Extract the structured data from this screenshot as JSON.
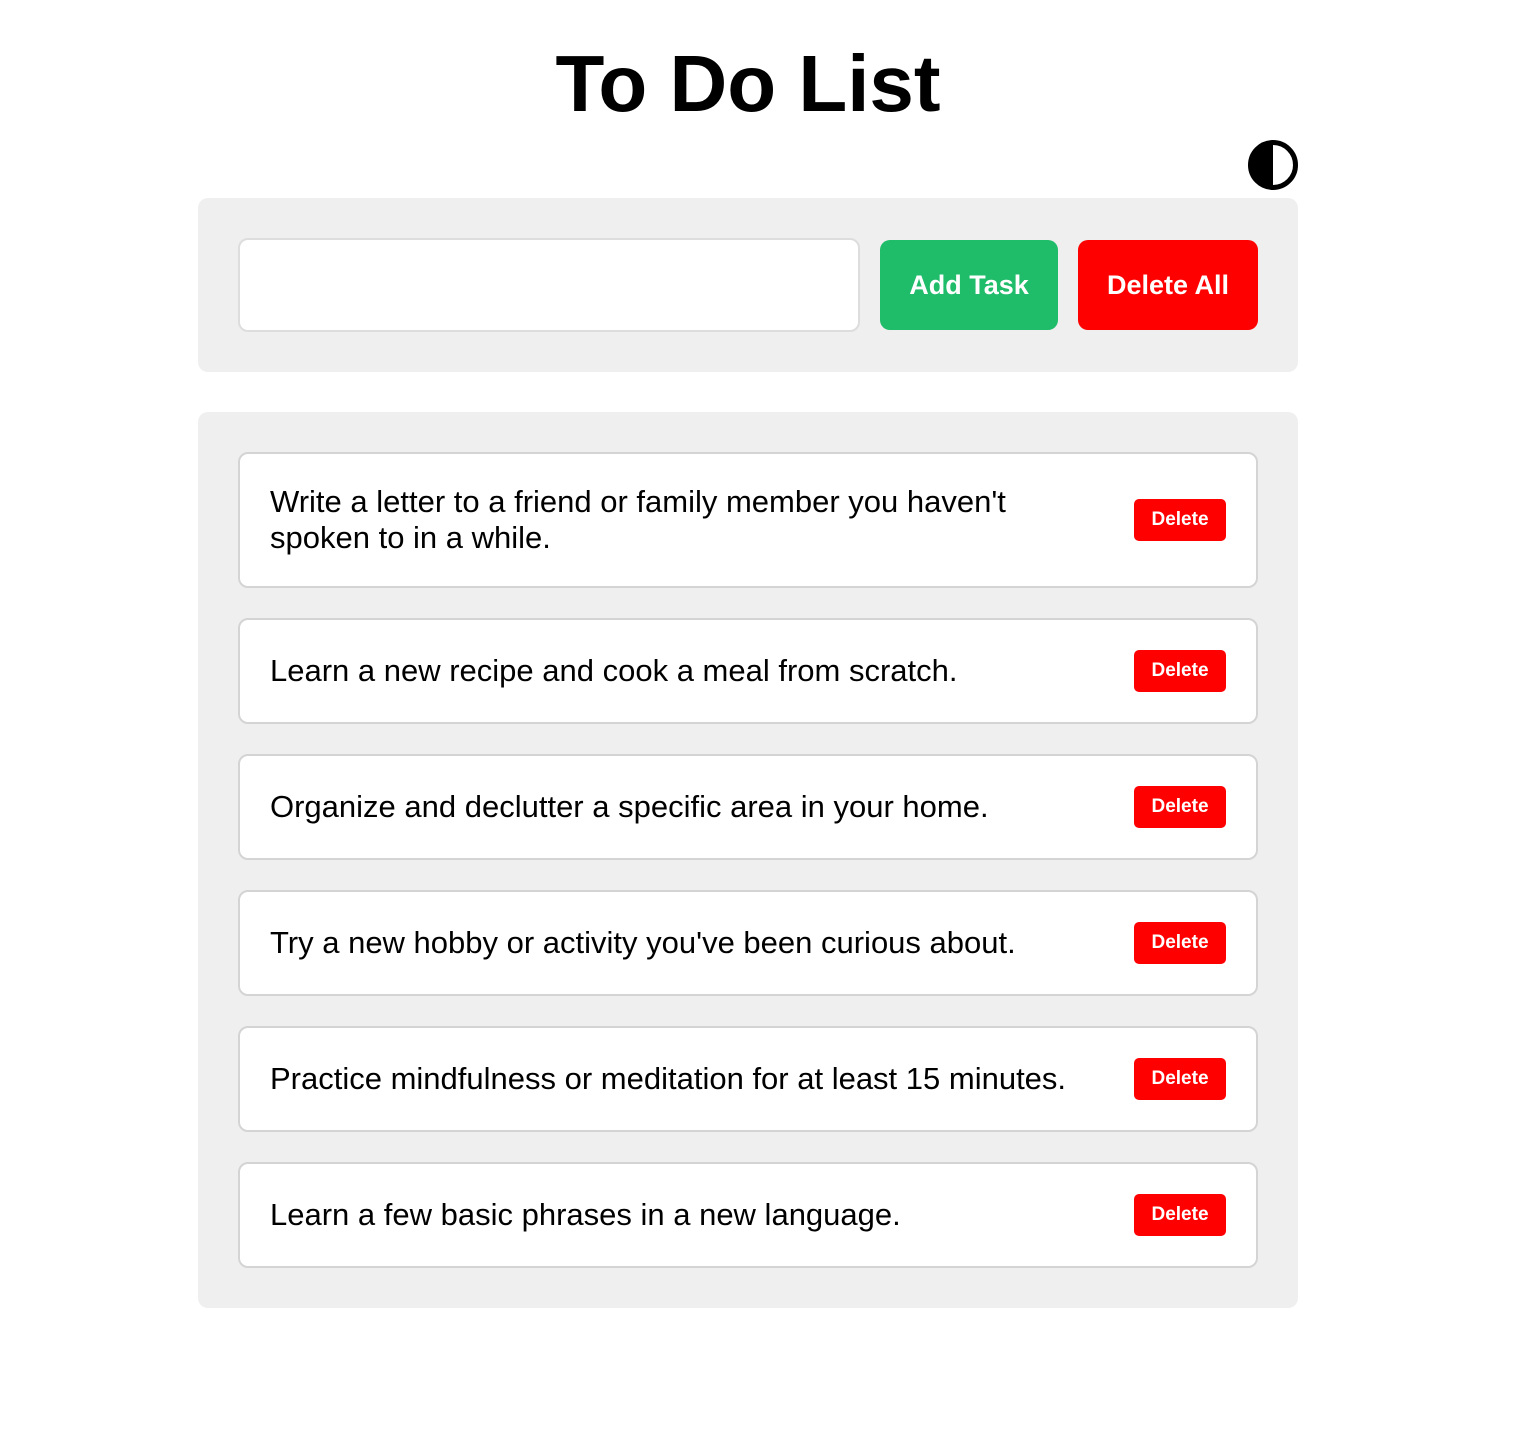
{
  "header": {
    "title": "To Do List",
    "theme_toggle_icon": "contrast-half-circle-icon"
  },
  "input": {
    "value": "",
    "placeholder": ""
  },
  "actions": {
    "add_label": "Add Task",
    "delete_all_label": "Delete All"
  },
  "tasks": [
    {
      "text": "Write a letter to a friend or family member you haven't spoken to in a while.",
      "delete_label": "Delete"
    },
    {
      "text": "Learn a new recipe and cook a meal from scratch.",
      "delete_label": "Delete"
    },
    {
      "text": "Organize and declutter a specific area in your home.",
      "delete_label": "Delete"
    },
    {
      "text": "Try a new hobby or activity you've been curious about.",
      "delete_label": "Delete"
    },
    {
      "text": "Practice mindfulness or meditation for at least 15 minutes.",
      "delete_label": "Delete"
    },
    {
      "text": "Learn a few basic phrases in a new language.",
      "delete_label": "Delete"
    }
  ],
  "colors": {
    "add_button": "#1fbc6a",
    "delete_button": "#ff0000",
    "panel_background": "#efefef"
  }
}
